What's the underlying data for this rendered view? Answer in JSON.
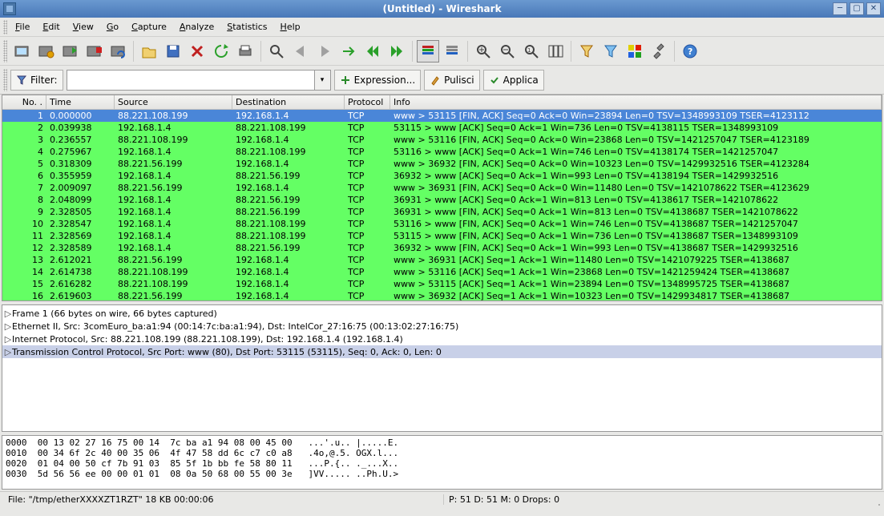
{
  "window": {
    "title": "(Untitled) - Wireshark"
  },
  "menu": [
    "File",
    "Edit",
    "View",
    "Go",
    "Capture",
    "Analyze",
    "Statistics",
    "Help"
  ],
  "toolbar_icons": [
    "interfaces-icon",
    "capture-options-icon",
    "capture-start-icon",
    "capture-stop-icon",
    "capture-restart-icon",
    "sep",
    "open-icon",
    "save-icon",
    "close-icon",
    "reload-icon",
    "print-icon",
    "sep",
    "find-icon",
    "go-back-icon",
    "go-forward-icon",
    "go-to-icon",
    "go-first-icon",
    "go-last-icon",
    "sep",
    "colorize-icon",
    "auto-scroll-icon",
    "sep",
    "zoom-in-icon",
    "zoom-out-icon",
    "zoom-100-icon",
    "resize-columns-icon",
    "sep",
    "capture-filters-icon",
    "display-filters-icon",
    "coloring-rules-icon",
    "preferences-icon",
    "sep",
    "help-icon"
  ],
  "filter": {
    "label": "Filter:",
    "value": "",
    "expression_btn": "Expression...",
    "clear_btn": "Pulisci",
    "apply_btn": "Applica"
  },
  "columns": [
    "No. .",
    "Time",
    "Source",
    "Destination",
    "Protocol",
    "Info"
  ],
  "packets": [
    {
      "no": 1,
      "time": "0.000000",
      "src": "88.221.108.199",
      "dst": "192.168.1.4",
      "proto": "TCP",
      "info": "www > 53115 [FIN, ACK] Seq=0 Ack=0 Win=23894 Len=0 TSV=1348993109 TSER=4123112",
      "sel": true
    },
    {
      "no": 2,
      "time": "0.039938",
      "src": "192.168.1.4",
      "dst": "88.221.108.199",
      "proto": "TCP",
      "info": "53115 > www [ACK] Seq=0 Ack=1 Win=736 Len=0 TSV=4138115 TSER=1348993109"
    },
    {
      "no": 3,
      "time": "0.236557",
      "src": "88.221.108.199",
      "dst": "192.168.1.4",
      "proto": "TCP",
      "info": "www > 53116 [FIN, ACK] Seq=0 Ack=0 Win=23868 Len=0 TSV=1421257047 TSER=4123189"
    },
    {
      "no": 4,
      "time": "0.275967",
      "src": "192.168.1.4",
      "dst": "88.221.108.199",
      "proto": "TCP",
      "info": "53116 > www [ACK] Seq=0 Ack=1 Win=746 Len=0 TSV=4138174 TSER=1421257047"
    },
    {
      "no": 5,
      "time": "0.318309",
      "src": "88.221.56.199",
      "dst": "192.168.1.4",
      "proto": "TCP",
      "info": "www > 36932 [FIN, ACK] Seq=0 Ack=0 Win=10323 Len=0 TSV=1429932516 TSER=4123284"
    },
    {
      "no": 6,
      "time": "0.355959",
      "src": "192.168.1.4",
      "dst": "88.221.56.199",
      "proto": "TCP",
      "info": "36932 > www [ACK] Seq=0 Ack=1 Win=993 Len=0 TSV=4138194 TSER=1429932516"
    },
    {
      "no": 7,
      "time": "2.009097",
      "src": "88.221.56.199",
      "dst": "192.168.1.4",
      "proto": "TCP",
      "info": "www > 36931 [FIN, ACK] Seq=0 Ack=0 Win=11480 Len=0 TSV=1421078622 TSER=4123629"
    },
    {
      "no": 8,
      "time": "2.048099",
      "src": "192.168.1.4",
      "dst": "88.221.56.199",
      "proto": "TCP",
      "info": "36931 > www [ACK] Seq=0 Ack=1 Win=813 Len=0 TSV=4138617 TSER=1421078622"
    },
    {
      "no": 9,
      "time": "2.328505",
      "src": "192.168.1.4",
      "dst": "88.221.56.199",
      "proto": "TCP",
      "info": "36931 > www [FIN, ACK] Seq=0 Ack=1 Win=813 Len=0 TSV=4138687 TSER=1421078622"
    },
    {
      "no": 10,
      "time": "2.328547",
      "src": "192.168.1.4",
      "dst": "88.221.108.199",
      "proto": "TCP",
      "info": "53116 > www [FIN, ACK] Seq=0 Ack=1 Win=746 Len=0 TSV=4138687 TSER=1421257047"
    },
    {
      "no": 11,
      "time": "2.328569",
      "src": "192.168.1.4",
      "dst": "88.221.108.199",
      "proto": "TCP",
      "info": "53115 > www [FIN, ACK] Seq=0 Ack=1 Win=736 Len=0 TSV=4138687 TSER=1348993109"
    },
    {
      "no": 12,
      "time": "2.328589",
      "src": "192.168.1.4",
      "dst": "88.221.56.199",
      "proto": "TCP",
      "info": "36932 > www [FIN, ACK] Seq=0 Ack=1 Win=993 Len=0 TSV=4138687 TSER=1429932516"
    },
    {
      "no": 13,
      "time": "2.612021",
      "src": "88.221.56.199",
      "dst": "192.168.1.4",
      "proto": "TCP",
      "info": "www > 36931 [ACK] Seq=1 Ack=1 Win=11480 Len=0 TSV=1421079225 TSER=4138687"
    },
    {
      "no": 14,
      "time": "2.614738",
      "src": "88.221.108.199",
      "dst": "192.168.1.4",
      "proto": "TCP",
      "info": "www > 53116 [ACK] Seq=1 Ack=1 Win=23868 Len=0 TSV=1421259424 TSER=4138687"
    },
    {
      "no": 15,
      "time": "2.616282",
      "src": "88.221.108.199",
      "dst": "192.168.1.4",
      "proto": "TCP",
      "info": "www > 53115 [ACK] Seq=1 Ack=1 Win=23894 Len=0 TSV=1348995725 TSER=4138687"
    },
    {
      "no": 16,
      "time": "2.619603",
      "src": "88.221.56.199",
      "dst": "192.168.1.4",
      "proto": "TCP",
      "info": "www > 36932 [ACK] Seq=1 Ack=1 Win=10323 Len=0 TSV=1429934817 TSER=4138687"
    }
  ],
  "details": [
    "Frame 1 (66 bytes on wire, 66 bytes captured)",
    "Ethernet II, Src: 3comEuro_ba:a1:94 (00:14:7c:ba:a1:94), Dst: IntelCor_27:16:75 (00:13:02:27:16:75)",
    "Internet Protocol, Src: 88.221.108.199 (88.221.108.199), Dst: 192.168.1.4 (192.168.1.4)",
    "Transmission Control Protocol, Src Port: www (80), Dst Port: 53115 (53115), Seq: 0, Ack: 0, Len: 0"
  ],
  "detail_selected_index": 3,
  "hex": [
    "0000  00 13 02 27 16 75 00 14  7c ba a1 94 08 00 45 00   ...'.u.. |.....E.",
    "0010  00 34 6f 2c 40 00 35 06  4f 47 58 dd 6c c7 c0 a8   .4o,@.5. OGX.l...",
    "0020  01 04 00 50 cf 7b 91 03  85 5f 1b bb fe 58 80 11   ...P.{.. ._...X..",
    "0030  5d 56 56 ee 00 00 01 01  08 0a 50 68 00 55 00 3e   ]VV..... ..Ph.U.>"
  ],
  "status": {
    "file": "File: \"/tmp/etherXXXXZT1RZT\" 18 KB 00:00:06",
    "pkts": "P: 51 D: 51 M: 0 Drops: 0"
  },
  "accent_select": "#4a86d8",
  "tcp_row": "#64ff64"
}
